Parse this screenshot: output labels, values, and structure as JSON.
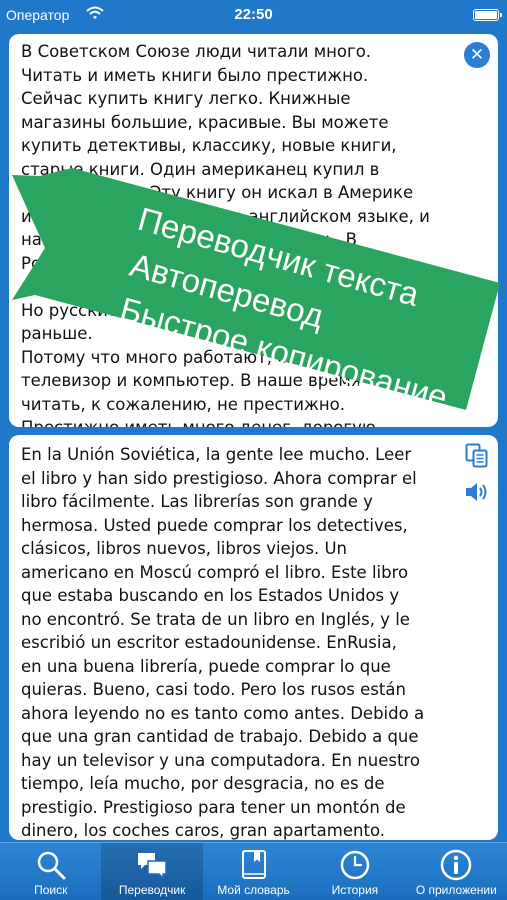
{
  "status_bar": {
    "carrier": "Оператор",
    "time": "22:50"
  },
  "source_panel": {
    "text": "В Советском Союзе люди читали много.\nЧитать и иметь книги было престижно.\nСейчас купить книгу легко. Книжные\nмагазины большие, красивые. Вы можете\nкупить детективы, классику, новые книги,\nстарые книги. Один американец купил в\nМоскве книгу. Эту книгу он искал в Америке\nи не нашёл. Это книга на английском языке, и\nнаписал её американский писатель. В\nРоссии, в хорошем магазине, можно купить\nмного книг. Ну, почти всё.\nНо русские сейчас читают не так много, как\nраньше.\nПотому что много работают, смотрят\nтелевизор и компьютер. В наше время\nчитать, к сожалению, не престижно.\nПрестижно иметь много денег, дорогую",
    "clear_icon": "close-circle-icon"
  },
  "target_panel": {
    "text": "En la Unión Soviética, la gente lee mucho. Leer\nel libro y han sido prestigioso. Ahora comprar el\nlibro fácilmente. Las librerías son grande y\nhermosa. Usted puede comprar los detectives,\nclásicos, libros nuevos, libros viejos. Un\namericano en Moscú compró el libro. Este libro\nque estaba buscando en los Estados Unidos y\nno encontró. Se trata de un libro en Inglés, y le\nescribió un escritor estadounidense. EnRusia,\nen una buena librería, puede comprar lo que\nquieras. Bueno, casi todo. Pero los rusos están\nahora leyendo no es tanto como antes. Debido a\nque una gran cantidad de trabajo. Debido a que\nhay un televisor y una computadora. En nuestro\ntiempo, leía mucho, por desgracia, no es de\nprestigio. Prestigioso para tener un montón de\ndinero, los coches caros, gran apartamento.",
    "copy_icon": "copy-icon",
    "speak_icon": "speaker-icon"
  },
  "promo_banner": {
    "color": "#2aa55f",
    "lines": [
      "Переводчик текста",
      "Автоперевод",
      "Быстрое копирование"
    ]
  },
  "tab_bar": {
    "tabs": [
      {
        "label": "Поиск",
        "icon": "search-icon"
      },
      {
        "label": "Переводчик",
        "icon": "chat-bubbles-icon",
        "active": true
      },
      {
        "label": "Мой словарь",
        "icon": "book-icon"
      },
      {
        "label": "История",
        "icon": "clock-icon"
      },
      {
        "label": "О приложении",
        "icon": "info-icon"
      }
    ]
  }
}
